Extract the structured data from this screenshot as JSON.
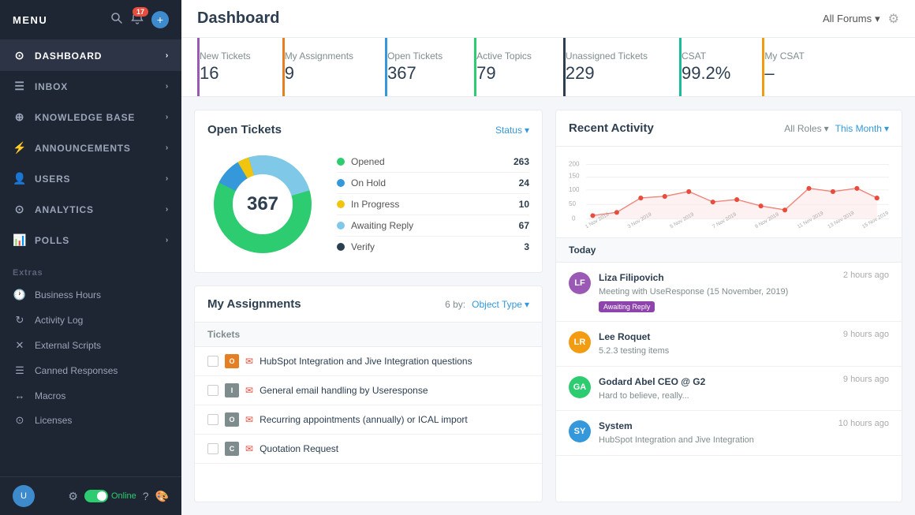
{
  "sidebar": {
    "logo": "MENU",
    "notification_count": "17",
    "nav_items": [
      {
        "id": "dashboard",
        "label": "DASHBOARD",
        "icon": "⊙",
        "active": true
      },
      {
        "id": "inbox",
        "label": "INBOX",
        "icon": "☰"
      },
      {
        "id": "knowledge-base",
        "label": "KNOWLEDGE BASE",
        "icon": "⊕"
      },
      {
        "id": "announcements",
        "label": "ANNOUNCEMENTS",
        "icon": "⚡"
      },
      {
        "id": "users",
        "label": "USERS",
        "icon": "👤"
      },
      {
        "id": "analytics",
        "label": "ANALYTICS",
        "icon": "⊙"
      },
      {
        "id": "polls",
        "label": "POLLS",
        "icon": "📊"
      }
    ],
    "extras_label": "Extras",
    "extras_items": [
      {
        "id": "business-hours",
        "label": "Business Hours",
        "icon": "🕐"
      },
      {
        "id": "activity-log",
        "label": "Activity Log",
        "icon": "↻"
      },
      {
        "id": "external-scripts",
        "label": "External Scripts",
        "icon": "✕"
      },
      {
        "id": "canned-responses",
        "label": "Canned Responses",
        "icon": "☰"
      },
      {
        "id": "macros",
        "label": "Macros",
        "icon": "↔"
      },
      {
        "id": "licenses",
        "label": "Licenses",
        "icon": "⊙"
      }
    ],
    "online_label": "Online",
    "footer": {
      "gear_label": "⚙",
      "help_label": "?",
      "color_label": "🎨"
    }
  },
  "header": {
    "title": "Dashboard",
    "forum_selector": "All Forums",
    "settings_icon": "⚙"
  },
  "stats": [
    {
      "id": "new-tickets",
      "label": "New Tickets",
      "value": "16",
      "color": "purple"
    },
    {
      "id": "my-assignments",
      "label": "My Assignments",
      "value": "9",
      "color": "orange"
    },
    {
      "id": "open-tickets",
      "label": "Open Tickets",
      "value": "367",
      "color": "blue"
    },
    {
      "id": "active-topics",
      "label": "Active Topics",
      "value": "79",
      "color": "green"
    },
    {
      "id": "unassigned-tickets",
      "label": "Unassigned Tickets",
      "value": "229",
      "color": "darkblue"
    },
    {
      "id": "csat",
      "label": "CSAT",
      "value": "99.2%",
      "color": "teal"
    },
    {
      "id": "my-csat",
      "label": "My CSAT",
      "value": "–",
      "color": "yellow"
    }
  ],
  "open_tickets": {
    "title": "Open Tickets",
    "status_label": "Status",
    "total": "367",
    "legend": [
      {
        "label": "Opened",
        "value": "263",
        "color": "#2ecc71"
      },
      {
        "label": "On Hold",
        "value": "24",
        "color": "#3498db"
      },
      {
        "label": "In Progress",
        "value": "10",
        "color": "#f1c40f"
      },
      {
        "label": "Awaiting Reply",
        "value": "67",
        "color": "#7fc8e8"
      },
      {
        "label": "Verify",
        "value": "3",
        "color": "#2c3e50"
      }
    ]
  },
  "my_assignments": {
    "title": "My Assignments",
    "count_label": "6 by:",
    "object_type_label": "Object Type",
    "section_label": "Tickets",
    "tickets": [
      {
        "badge_letter": "O",
        "badge_color": "#e67e22",
        "has_email": true,
        "name": "HubSpot Integration and Jive Integration questions"
      },
      {
        "badge_letter": "I",
        "badge_color": "#7f8c8d",
        "has_email": true,
        "name": "General email handling by Useresponse"
      },
      {
        "badge_letter": "O",
        "badge_color": "#7f8c8d",
        "has_email": true,
        "name": "Recurring appointments (annually) or ICAL import"
      },
      {
        "badge_letter": "C",
        "badge_color": "#7f8c8d",
        "has_email": true,
        "name": "Quotation Request"
      }
    ]
  },
  "recent_activity": {
    "title": "Recent Activity",
    "all_roles_label": "All Roles",
    "this_month_label": "This Month",
    "chart_y_labels": [
      "200",
      "150",
      "100",
      "50",
      "0"
    ],
    "chart_x_labels": [
      "1 Nov 2019",
      "3 Nov 2019",
      "5 Nov 2019",
      "7 Nov 2019",
      "9 Nov 2019",
      "11 Nov 2019",
      "13 Nov 2019",
      "15 Nov 2019"
    ],
    "today_label": "Today",
    "activities": [
      {
        "id": "liza",
        "avatar_initials": "LF",
        "avatar_color": "#9b59b6",
        "name": "Liza Filipovich",
        "time": "2 hours ago",
        "description": "Meeting with UseResponse (15 November, 2019)",
        "badge": "Awaiting Reply"
      },
      {
        "id": "lee",
        "avatar_initials": "LR",
        "avatar_color": "#f39c12",
        "name": "Lee Roquet",
        "time": "9 hours ago",
        "description": "5.2.3 testing items",
        "badge": null
      },
      {
        "id": "godard",
        "avatar_initials": "GA",
        "avatar_color": "#2ecc71",
        "name": "Godard Abel CEO @ G2",
        "time": "9 hours ago",
        "description": "Hard to believe, really...",
        "badge": null
      },
      {
        "id": "system",
        "avatar_initials": "SY",
        "avatar_color": "#3498db",
        "name": "System",
        "time": "10 hours ago",
        "description": "HubSpot Integration and Jive Integration",
        "badge": null
      }
    ]
  }
}
